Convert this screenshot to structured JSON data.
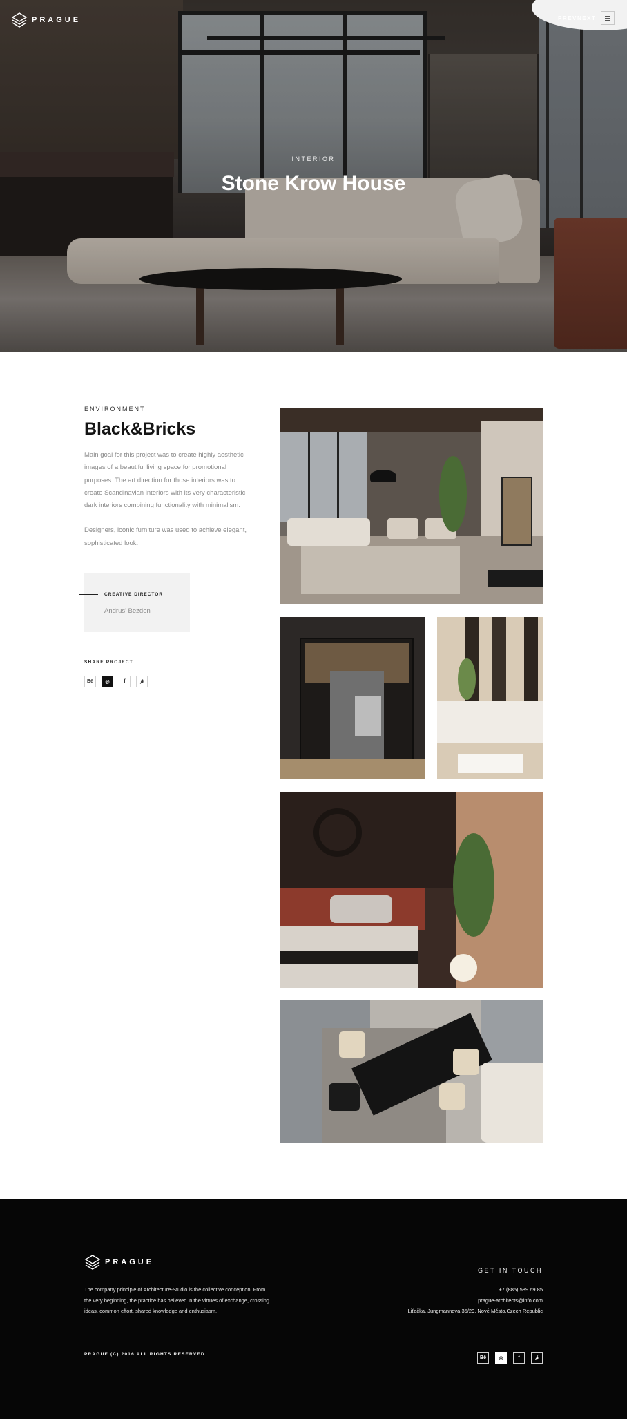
{
  "header": {
    "logo_text": "PRAGUE",
    "nav_prev": "PREV",
    "nav_next": "NEXT",
    "menu_icon": "hamburger-icon"
  },
  "hero": {
    "category": "INTERIOR",
    "title": "Stone Krow House"
  },
  "project": {
    "section_label": "ENVIRONMENT",
    "title": "Black&Bricks",
    "description_1": "Main goal for this project was to create highly aesthetic images of a beautiful living space for promotional purposes. The art direction for those interiors was to create Scandinavian interiors with its very characteristic dark interiors combining functionality with minimalism.",
    "description_2": "Designers, iconic furniture was used to achieve elegant, sophisticated look.",
    "credit_role": "CREATIVE DIRECTOR",
    "credit_name": "Andrus' Bezden",
    "share_label": "SHARE PROJECT",
    "share_icons": [
      {
        "name": "behance-icon",
        "glyph": "Bē"
      },
      {
        "name": "dribbble-icon",
        "glyph": "◎"
      },
      {
        "name": "facebook-icon",
        "glyph": "f"
      },
      {
        "name": "pinterest-icon",
        "glyph": "𝓅"
      }
    ]
  },
  "footer": {
    "logo_text": "PRAGUE",
    "about": "The company principle of Architecture-Studio is the collective conception. From the very beginning, the practice has believed in the virtues of exchange, crossing ideas, common effort, shared knowledge and enthusiasm.",
    "contact_title": "GET IN TOUCH",
    "phone": "+7 (885) 589 69 85",
    "email": "prague-architects@info.com",
    "address": "Liťačka, Jungmannova 35/29, Nové Město,Czech Republic",
    "copyright": "PRAGUE (C) 2016 ALL RIGHTS RESERVED",
    "social_icons": [
      {
        "name": "behance-icon",
        "glyph": "Bē"
      },
      {
        "name": "dribbble-icon",
        "glyph": "◎"
      },
      {
        "name": "facebook-icon",
        "glyph": "f"
      },
      {
        "name": "pinterest-icon",
        "glyph": "𝓅"
      }
    ]
  },
  "colors": {
    "footer_bg": "#060606",
    "credit_box_bg": "#f2f2f2",
    "body_text": "#8a8a8a"
  }
}
